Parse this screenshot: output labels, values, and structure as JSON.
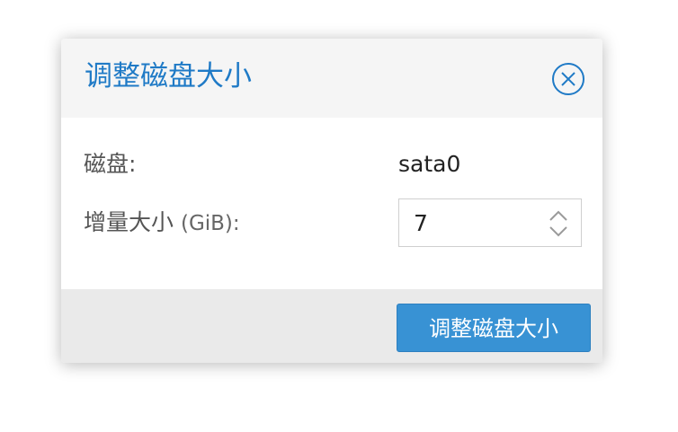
{
  "dialog": {
    "title": "调整磁盘大小",
    "close_icon": "close-circle-icon"
  },
  "form": {
    "disk_label": "磁盘:",
    "disk_value": "sata0",
    "size_label_main": "增量大小",
    "size_label_unit": "(GiB):",
    "size_value": "7"
  },
  "footer": {
    "submit_label": "调整磁盘大小"
  },
  "colors": {
    "accent": "#1f7ac6",
    "button": "#3892d4",
    "header_bg": "#f5f5f5",
    "footer_bg": "#eaeaea"
  }
}
